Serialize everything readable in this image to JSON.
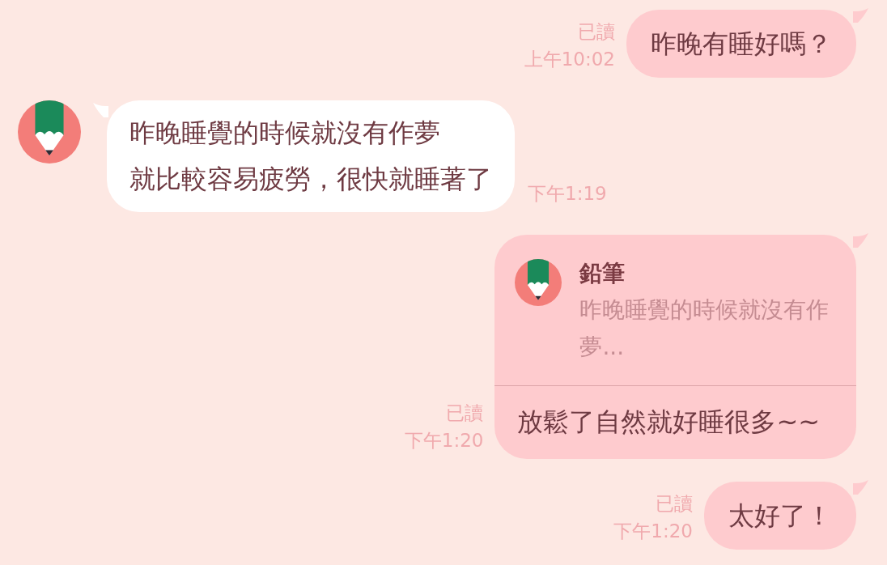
{
  "messages": [
    {
      "kind": "sent",
      "status": "已讀",
      "time": "上午10:02",
      "lines": [
        "昨晚有睡好嗎？"
      ]
    },
    {
      "kind": "received",
      "time": "下午1:19",
      "lines": [
        "昨晚睡覺的時候就沒有作夢",
        "就比較容易疲勞，很快就睡著了"
      ]
    },
    {
      "kind": "sent",
      "status": "已讀",
      "time": "下午1:20",
      "quote": {
        "name": "鉛筆",
        "text": "昨晚睡覺的時候就沒有作夢..."
      },
      "lines": [
        "放鬆了自然就好睡很多~~"
      ]
    },
    {
      "kind": "sent",
      "status": "已讀",
      "time": "下午1:20",
      "lines": [
        "太好了！"
      ]
    }
  ]
}
